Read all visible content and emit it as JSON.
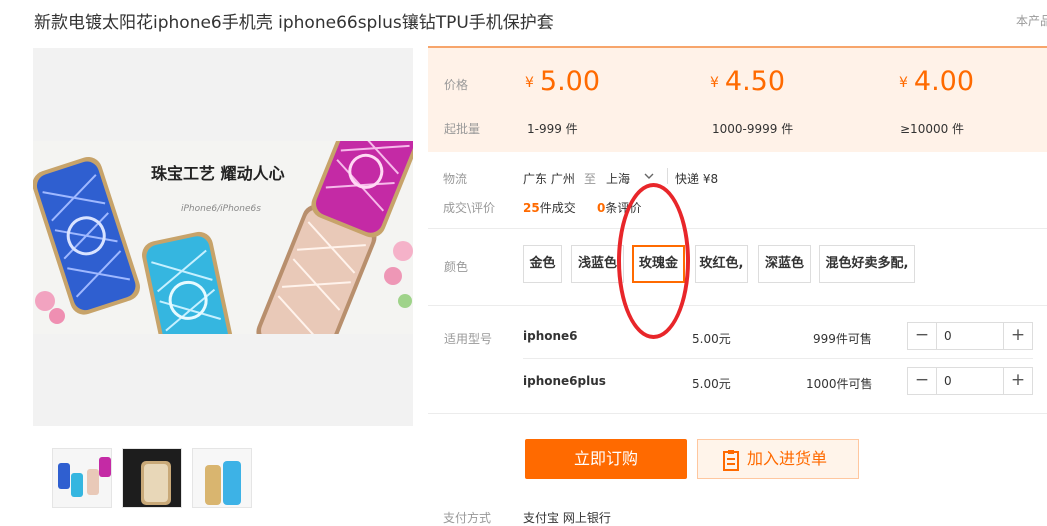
{
  "product": {
    "title": "新款电镀太阳花iphone6手机壳 iphone66splus镶钻TPU手机保护套",
    "top_right": "本产品",
    "banner_slogan": "珠宝工艺 耀动人心",
    "banner_sub": "iPhone6/iPhone6s"
  },
  "pricing": {
    "price_label": "价格",
    "moq_label": "起批量",
    "currency": "¥",
    "tiers": [
      {
        "price": "5.00",
        "range": "1-999 件"
      },
      {
        "price": "4.50",
        "range": "1000-9999 件"
      },
      {
        "price": "4.00",
        "range": "≥10000 件"
      }
    ]
  },
  "logistics": {
    "label": "物流",
    "from": "广东 广州",
    "to_word": "至",
    "to": "上海",
    "shipping": "快递 ¥8"
  },
  "deals": {
    "label": "成交\\评价",
    "sold_count": "25",
    "sold_suffix": "件成交",
    "review_count": "0",
    "review_suffix": "条评价"
  },
  "colors": {
    "label": "颜色",
    "options": [
      "金色",
      "浅蓝色",
      "玫瑰金",
      "玫红色,",
      "深蓝色",
      "混色好卖多配,"
    ],
    "selected": "玫瑰金"
  },
  "models": {
    "label": "适用型号",
    "rows": [
      {
        "name": "iphone6",
        "price": "5.00元",
        "stock": "999件可售",
        "qty": "0"
      },
      {
        "name": "iphone6plus",
        "price": "5.00元",
        "stock": "1000件可售",
        "qty": "0"
      }
    ]
  },
  "actions": {
    "order": "立即订购",
    "add_to_list": "加入进货单"
  },
  "payment": {
    "label": "支付方式",
    "value": "支付宝  网上银行"
  },
  "icons": {
    "dropdown": "chevron-down-icon",
    "cart_list": "clipboard-icon",
    "minus": "minus-icon",
    "plus": "plus-icon"
  },
  "theme": {
    "accent": "#ff6a00",
    "price_bg": "#fff2e8",
    "highlight_circle": "#e8262a"
  }
}
